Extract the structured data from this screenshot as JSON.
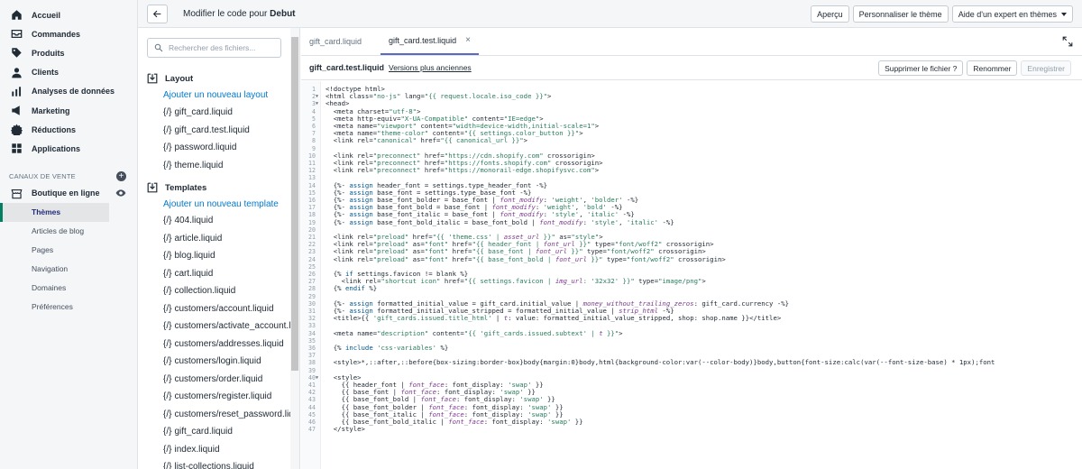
{
  "nav": {
    "items": [
      {
        "label": "Accueil",
        "icon": "home-icon"
      },
      {
        "label": "Commandes",
        "icon": "orders-icon"
      },
      {
        "label": "Produits",
        "icon": "tag-icon"
      },
      {
        "label": "Clients",
        "icon": "customers-icon"
      },
      {
        "label": "Analyses de données",
        "icon": "analytics-icon"
      },
      {
        "label": "Marketing",
        "icon": "marketing-icon"
      },
      {
        "label": "Réductions",
        "icon": "discount-icon"
      },
      {
        "label": "Applications",
        "icon": "apps-icon"
      }
    ],
    "channels_heading": "CANAUX DE VENTE",
    "store_label": "Boutique en ligne",
    "store_sub": [
      "Thèmes",
      "Articles de blog",
      "Pages",
      "Navigation",
      "Domaines",
      "Préférences"
    ],
    "active_sub": "Thèmes"
  },
  "topbar": {
    "title_prefix": "Modifier le code pour",
    "theme_name": "Debut",
    "preview_label": "Aperçu",
    "customize_label": "Personnaliser le thème",
    "expert_label": "Aide d'un expert en thèmes"
  },
  "files": {
    "search_placeholder": "Rechercher des fichiers...",
    "layout_heading": "Layout",
    "layout_add": "Ajouter un nouveau layout",
    "layout_files": [
      "gift_card.liquid",
      "gift_card.test.liquid",
      "password.liquid",
      "theme.liquid"
    ],
    "templates_heading": "Templates",
    "templates_add": "Ajouter un nouveau template",
    "template_files": [
      "404.liquid",
      "article.liquid",
      "blog.liquid",
      "cart.liquid",
      "collection.liquid",
      "customers/account.liquid",
      "customers/activate_account.liquid",
      "customers/addresses.liquid",
      "customers/login.liquid",
      "customers/order.liquid",
      "customers/register.liquid",
      "customers/reset_password.liquid",
      "gift_card.liquid",
      "index.liquid",
      "list-collections.liquid"
    ],
    "brace": "{/}"
  },
  "editor": {
    "tabs": [
      {
        "label": "gift_card.liquid",
        "active": false
      },
      {
        "label": "gift_card.test.liquid",
        "active": true
      }
    ],
    "close_glyph": "×",
    "file_name": "gift_card.test.liquid",
    "versions_label": "Versions plus anciennes",
    "delete_label": "Supprimer le fichier ?",
    "rename_label": "Renommer",
    "save_label": "Enregistrer",
    "lines": [
      "<!doctype html>",
      "<html class=\"no-js\" lang=\"{{ request.locale.iso_code }}\">",
      "<head>",
      "  <meta charset=\"utf-8\">",
      "  <meta http-equiv=\"X-UA-Compatible\" content=\"IE=edge\">",
      "  <meta name=\"viewport\" content=\"width=device-width,initial-scale=1\">",
      "  <meta name=\"theme-color\" content=\"{{ settings.color_button }}\">",
      "  <link rel=\"canonical\" href=\"{{ canonical_url }}\">",
      "",
      "  <link rel=\"preconnect\" href=\"https://cdn.shopify.com\" crossorigin>",
      "  <link rel=\"preconnect\" href=\"https://fonts.shopify.com\" crossorigin>",
      "  <link rel=\"preconnect\" href=\"https://monorail-edge.shopifysvc.com\">",
      "",
      "  {%- assign header_font = settings.type_header_font -%}",
      "  {%- assign base_font = settings.type_base_font -%}",
      "  {%- assign base_font_bolder = base_font | font_modify: 'weight', 'bolder' -%}",
      "  {%- assign base_font_bold = base_font | font_modify: 'weight', 'bold' -%}",
      "  {%- assign base_font_italic = base_font | font_modify: 'style', 'italic' -%}",
      "  {%- assign base_font_bold_italic = base_font_bold | font_modify: 'style', 'italic' -%}",
      "",
      "  <link rel=\"preload\" href=\"{{ 'theme.css' | asset_url }}\" as=\"style\">",
      "  <link rel=\"preload\" as=\"font\" href=\"{{ header_font | font_url }}\" type=\"font/woff2\" crossorigin>",
      "  <link rel=\"preload\" as=\"font\" href=\"{{ base_font | font_url }}\" type=\"font/woff2\" crossorigin>",
      "  <link rel=\"preload\" as=\"font\" href=\"{{ base_font_bold | font_url }}\" type=\"font/woff2\" crossorigin>",
      "",
      "  {% if settings.favicon != blank %}",
      "    <link rel=\"shortcut icon\" href=\"{{ settings.favicon | img_url: '32x32' }}\" type=\"image/png\">",
      "  {% endif %}",
      "",
      "  {%- assign formatted_initial_value = gift_card.initial_value | money_without_trailing_zeros: gift_card.currency -%}",
      "  {%- assign formatted_initial_value_stripped = formatted_initial_value | strip_html -%}",
      "  <title>{{ 'gift_cards.issued.title_html' | t: value: formatted_initial_value_stripped, shop: shop.name }}</title>",
      "",
      "  <meta name=\"description\" content=\"{{ 'gift_cards.issued.subtext' | t }}\">",
      "",
      "  {% include 'css-variables' %}",
      "",
      "  <style>*,::after,::before{box-sizing:border-box}body{margin:0}body,html{background-color:var(--color-body)}body,button{font-size:calc(var(--font-size-base) * 1px);font",
      "",
      "  <style>",
      "    {{ header_font | font_face: font_display: 'swap' }}",
      "    {{ base_font | font_face: font_display: 'swap' }}",
      "    {{ base_font_bold | font_face: font_display: 'swap' }}",
      "    {{ base_font_bolder | font_face: font_display: 'swap' }}",
      "    {{ base_font_italic | font_face: font_display: 'swap' }}",
      "    {{ base_font_bold_italic | font_face: font_display: 'swap' }}",
      "  </style>"
    ],
    "fold_lines": [
      2,
      3,
      40
    ]
  }
}
